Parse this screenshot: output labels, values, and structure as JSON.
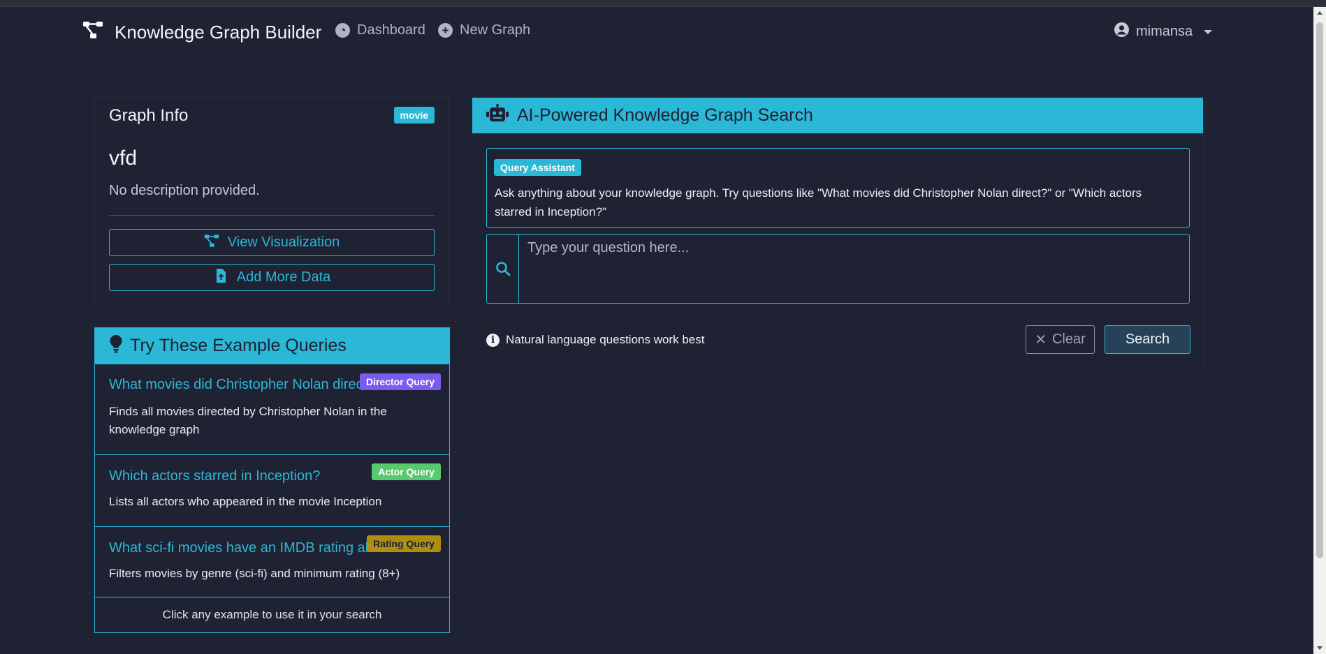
{
  "navbar": {
    "brand": "Knowledge Graph Builder",
    "links": [
      {
        "label": "Dashboard",
        "icon": "dashboard-icon"
      },
      {
        "label": "New Graph",
        "icon": "plus-circle-icon"
      }
    ],
    "user": "mimansa"
  },
  "graph_info": {
    "title": "Graph Info",
    "badge": "movie",
    "name": "vfd",
    "description": "No description provided.",
    "view_button": "View Visualization",
    "add_button": "Add More Data"
  },
  "examples": {
    "title": "Try These Example Queries",
    "items": [
      {
        "title": "What movies did Christopher Nolan direct?",
        "description": "Finds all movies directed by Christopher Nolan in the knowledge graph",
        "badge": "Director Query"
      },
      {
        "title": "Which actors starred in Inception?",
        "description": "Lists all actors who appeared in the movie Inception",
        "badge": "Actor Query"
      },
      {
        "title": "What sci-fi movies have an IMDB rating above 8?",
        "description": "Filters movies by genre (sci-fi) and minimum rating (8+)",
        "badge": "Rating Query"
      }
    ],
    "footer": "Click any example to use it in your search"
  },
  "search": {
    "title": "AI-Powered Knowledge Graph Search",
    "assistant_badge": "Query Assistant",
    "assistant_text": "Ask anything about your knowledge graph. Try questions like \"What movies did Christopher Nolan direct?\" or \"Which actors starred in Inception?\"",
    "placeholder": "Type your question here...",
    "hint": "Natural language questions work best",
    "clear_label": "Clear",
    "search_label": "Search"
  },
  "colors": {
    "background": "#1e2233",
    "accent": "#2bb8d7",
    "director_badge": "#7b5cf0",
    "actor_badge": "#57c96e",
    "rating_badge": "#b8940b"
  }
}
